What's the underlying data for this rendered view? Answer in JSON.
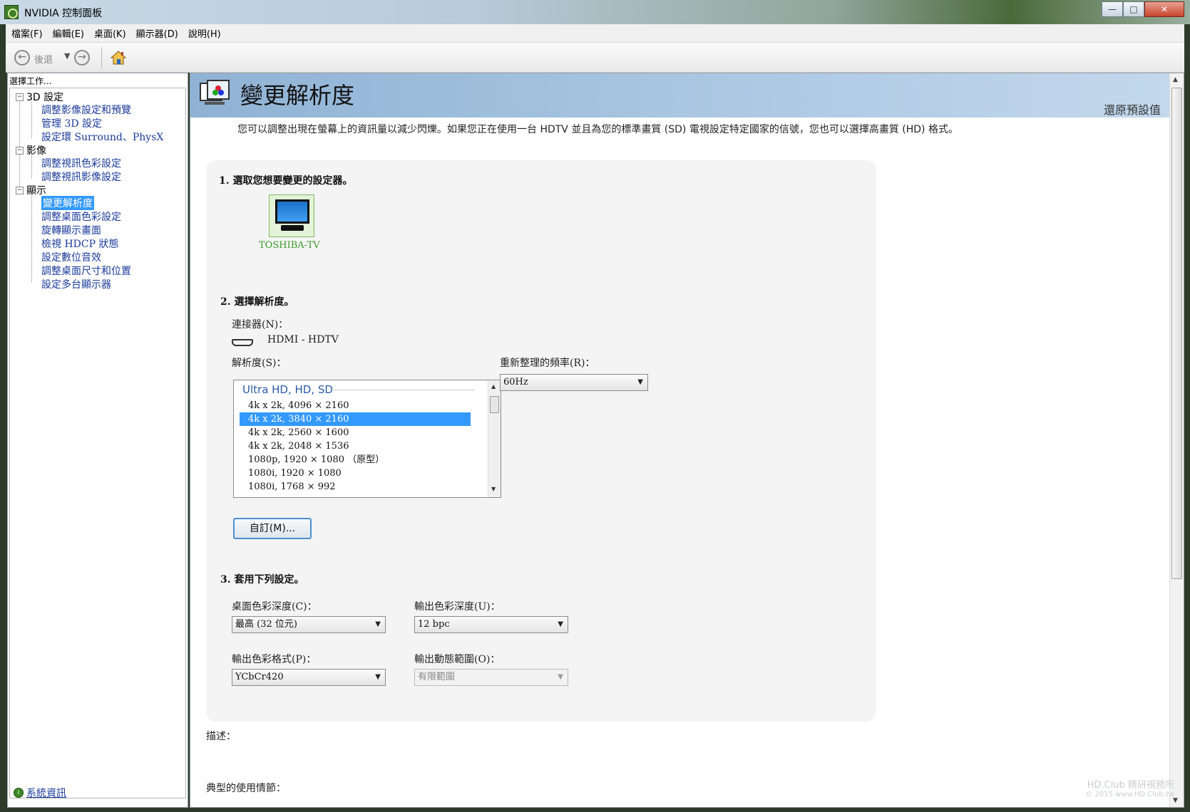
{
  "window": {
    "title": "NVIDIA 控制面板",
    "buttons": [
      "—",
      "□",
      "✕"
    ]
  },
  "menu": [
    "檔案(F)",
    "編輯(E)",
    "桌面(K)",
    "顯示器(D)",
    "說明(H)"
  ],
  "toolbar": {
    "back_label": "後退",
    "back_icon": "left-arrow",
    "forward_icon": "right-arrow",
    "home_icon": "home-icon"
  },
  "sidebar": {
    "header": "選擇工作...",
    "groups": [
      {
        "label": "3D 設定",
        "items": [
          "調整影像設定和預覽",
          "管理 3D 設定",
          "設定環 Surround、PhysX"
        ]
      },
      {
        "label": "影像",
        "items": [
          "調整視訊色彩設定",
          "調整視訊影像設定"
        ]
      },
      {
        "label": "顯示",
        "items": [
          "變更解析度",
          "調整桌面色彩設定",
          "旋轉顯示畫面",
          "檢視 HDCP 狀態",
          "設定數位音效",
          "調整桌面尺寸和位置",
          "設定多台顯示器"
        ]
      }
    ],
    "selected": "變更解析度",
    "system_info": "系統資訊"
  },
  "page": {
    "title": "變更解析度",
    "restore_defaults": "還原預設值",
    "intro": "您可以調整出現在螢幕上的資訊量以減少閃爍。如果您正在使用一台 HDTV 並且為您的標準畫質 (SD) 電視設定特定國家的信號，您也可以選擇高畫質 (HD) 格式。",
    "section1": {
      "title": "1. 選取您想要變更的設定器。",
      "display_name": "TOSHIBA-TV"
    },
    "section2": {
      "title": "2. 選擇解析度。",
      "connector_label": "連接器(N)：",
      "connector_value": "HDMI - HDTV",
      "resolution_label": "解析度(S)：",
      "resolution_group": "Ultra HD, HD, SD",
      "resolutions": [
        "4k x 2k, 4096 × 2160",
        "4k x 2k, 3840 × 2160",
        "4k x 2k, 2560 × 1600",
        "4k x 2k, 2048 × 1536",
        "1080p, 1920 × 1080 （原型）",
        "1080i, 1920 × 1080",
        "1080i, 1768 × 992"
      ],
      "selected_resolution": "4k x 2k, 3840 × 2160",
      "refresh_label": "重新整理的頻率(R)：",
      "refresh_value": "60Hz",
      "custom_button": "自訂(M)..."
    },
    "section3": {
      "title": "3. 套用下列設定。",
      "desktop_depth_label": "桌面色彩深度(C)：",
      "desktop_depth_value": "最高 (32 位元)",
      "output_depth_label": "輸出色彩深度(U)：",
      "output_depth_value": "12 bpc",
      "output_format_label": "輸出色彩格式(P)：",
      "output_format_value": "YCbCr420",
      "output_range_label": "輸出動態範圍(O)：",
      "output_range_value": "有限範圍"
    },
    "description_label": "描述：",
    "usage_label": "典型的使用情節："
  },
  "watermark": {
    "line1": "HD.Club 精研視務所",
    "line2": "© 2015 www.HD.Club.tw"
  }
}
